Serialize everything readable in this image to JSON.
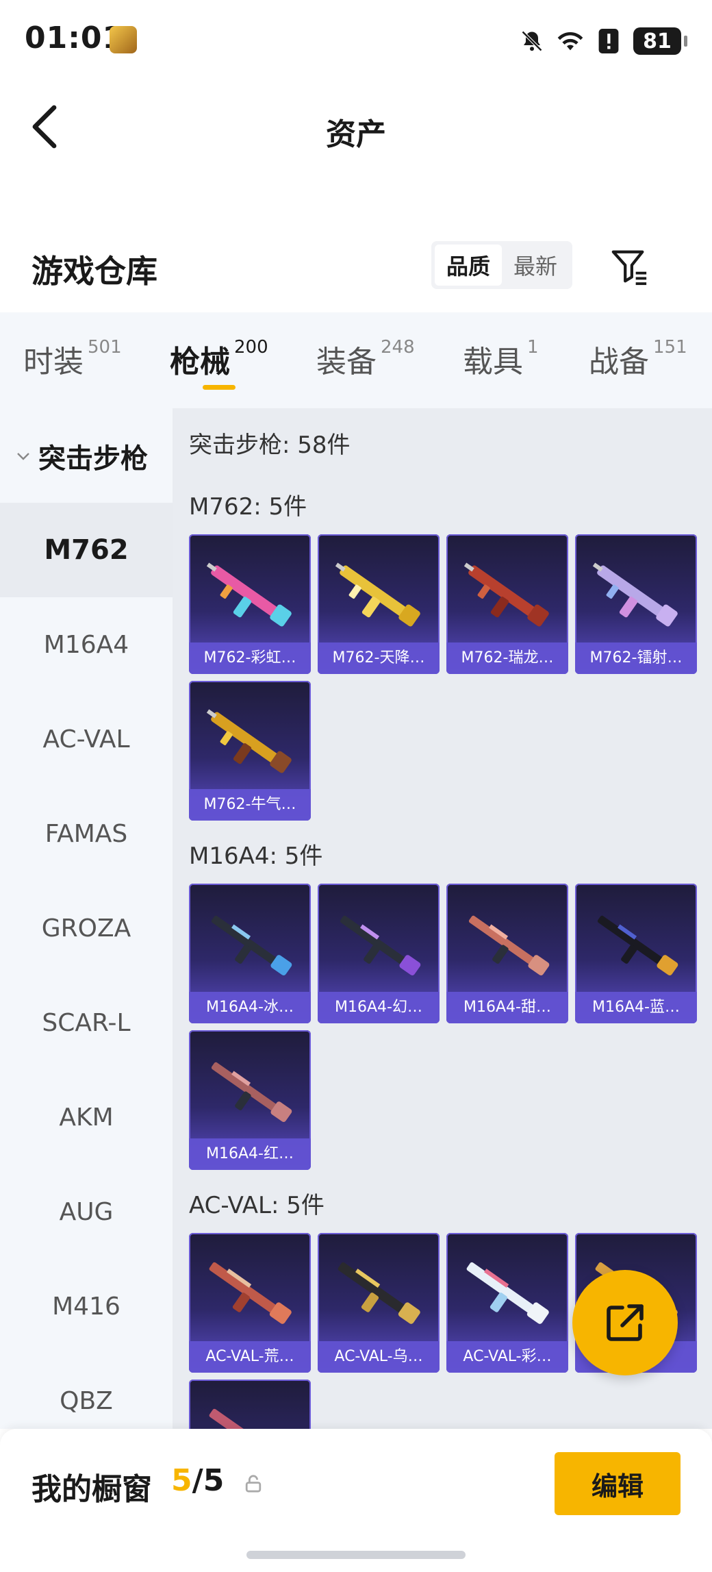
{
  "status_bar": {
    "time": "01:01",
    "battery": "81",
    "icons": [
      "app-icon",
      "mute-bell-icon",
      "wifi-icon",
      "alert-icon",
      "battery-icon"
    ]
  },
  "nav": {
    "title": "资产",
    "back_icon": "chevron-left-icon"
  },
  "section": {
    "title": "游戏仓库",
    "sort_options": [
      "品质",
      "最新"
    ],
    "sort_selected": "品质",
    "filter_icon": "filter-icon"
  },
  "category_tabs": [
    {
      "label": "时装",
      "count": "501"
    },
    {
      "label": "枪械",
      "count": "200",
      "active": true
    },
    {
      "label": "装备",
      "count": "248"
    },
    {
      "label": "载具",
      "count": "1"
    },
    {
      "label": "战备",
      "count": "151"
    }
  ],
  "sidebar": {
    "group_label": "突击步枪",
    "items": [
      "M762",
      "M16A4",
      "AC-VAL",
      "FAMAS",
      "GROZA",
      "SCAR-L",
      "AKM",
      "AUG",
      "M416",
      "QBZ"
    ],
    "active": "M762"
  },
  "content": {
    "heading": "突击步枪: 58件",
    "groups": [
      {
        "title": "M762: 5件",
        "items": [
          "M762-彩虹…",
          "M762-天降…",
          "M762-瑞龙…",
          "M762-镭射…",
          "M762-牛气…"
        ]
      },
      {
        "title": "M16A4: 5件",
        "items": [
          "M16A4-冰…",
          "M16A4-幻…",
          "M16A4-甜…",
          "M16A4-蓝…",
          "M16A4-红…"
        ]
      },
      {
        "title": "AC-VAL: 5件",
        "items": [
          "AC-VAL-荒…",
          "AC-VAL-乌…",
          "AC-VAL-彩…",
          "",
          ""
        ]
      }
    ]
  },
  "colors": {
    "accent": "#f7b500",
    "card_bg": "#2e2869",
    "card_label_bg": "#6252d2"
  },
  "fab_icon": "share-external-icon",
  "bottom_bar": {
    "title": "我的橱窗",
    "count_current": "5",
    "count_total": "/5",
    "lock_icon": "lock-icon",
    "edit_label": "编辑"
  }
}
